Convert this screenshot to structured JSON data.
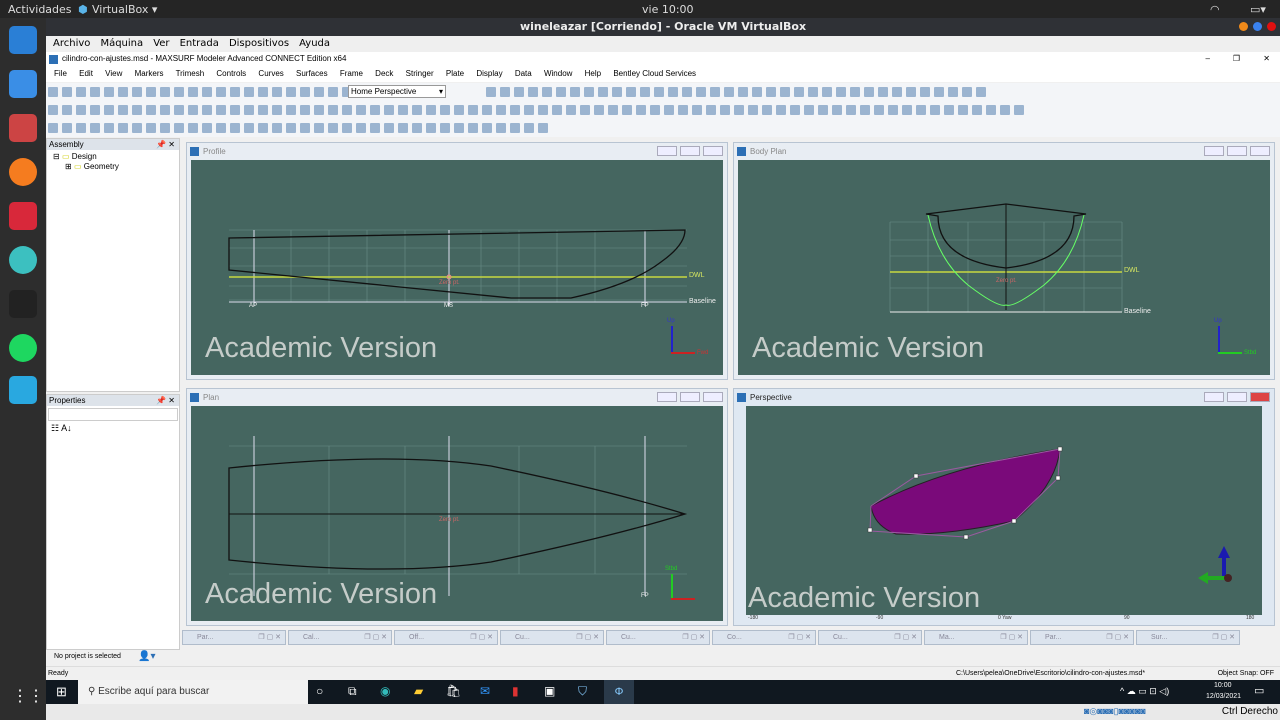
{
  "topbar": {
    "activities": "Actividades",
    "app": "VirtualBox ▾",
    "clock": "vie 10:00"
  },
  "vbox": {
    "title": "wineleazar [Corriendo] - Oracle VM VirtualBox",
    "menu": [
      "Archivo",
      "Máquina",
      "Ver",
      "Entrada",
      "Dispositivos",
      "Ayuda"
    ],
    "host_key": "Ctrl Derecho"
  },
  "maxsurf": {
    "title": "cilindro-con-ajustes.msd - MAXSURF Modeler Advanced CONNECT Edition x64",
    "menu": [
      "File",
      "Edit",
      "View",
      "Markers",
      "Trimesh",
      "Controls",
      "Curves",
      "Surfaces",
      "Frame",
      "Deck",
      "Stringer",
      "Plate",
      "Display",
      "Data",
      "Window",
      "Help",
      "Bentley Cloud Services"
    ],
    "view_select": "Home Perspective"
  },
  "assembly": {
    "title": "Assembly",
    "tree": [
      "Design",
      "Geometry"
    ]
  },
  "properties": {
    "title": "Properties"
  },
  "viewports": {
    "profile": {
      "title": "Profile",
      "labels": {
        "dwl": "DWL",
        "baseline": "Baseline",
        "ap": "AP",
        "ms": "MS",
        "fp": "FP",
        "zero": "Zero pt.",
        "up": "Up",
        "fwd": "Fwd"
      }
    },
    "bodyplan": {
      "title": "Body Plan",
      "labels": {
        "dwl": "DWL",
        "baseline": "Baseline",
        "zero": "Zero pt.",
        "up": "Up",
        "stbd": "Stbd"
      }
    },
    "plan": {
      "title": "Plan",
      "labels": {
        "zero": "Zero pt.",
        "stbd": "Stbd",
        "fp": "FP"
      }
    },
    "perspective": {
      "title": "Perspective",
      "ruler": [
        "-180",
        "-90",
        "0 Yaw",
        "90",
        "180"
      ]
    },
    "watermark": "Academic Version"
  },
  "min_tabs": [
    "Par...",
    "Cal...",
    "Off...",
    "Cu...",
    "Cu...",
    "Co...",
    "Cu...",
    "Ma...",
    "Par...",
    "Sur..."
  ],
  "status": {
    "project": "No project is selected",
    "ready": "Ready",
    "path": "C:\\Users\\pelea\\OneDrive\\Escritorio\\cilindro-con-ajustes.msd*",
    "snap": "Object Snap: OFF"
  },
  "taskbar": {
    "search": "Escribe aquí para buscar",
    "time": "10:00",
    "date": "12/03/2021"
  }
}
